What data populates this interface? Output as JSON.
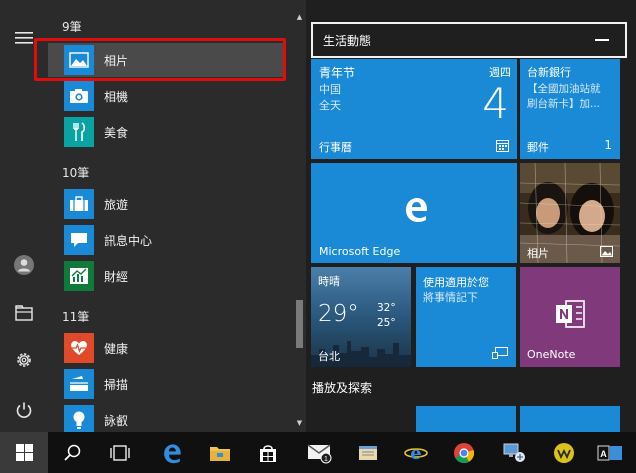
{
  "app_list": {
    "groups": [
      {
        "header": "9筆",
        "items": [
          {
            "label": "相片"
          },
          {
            "label": "相機"
          },
          {
            "label": "美食"
          }
        ]
      },
      {
        "header": "10筆",
        "items": [
          {
            "label": "旅遊"
          },
          {
            "label": "訊息中心"
          },
          {
            "label": "財經"
          }
        ]
      },
      {
        "header": "11筆",
        "items": [
          {
            "label": "健康"
          },
          {
            "label": "掃描"
          },
          {
            "label": "詠叡"
          }
        ]
      }
    ]
  },
  "tiles_section": {
    "header": "生活動態",
    "calendar": {
      "line1": "青年节",
      "line2": "中国",
      "line3": "全天",
      "weekday": "週四",
      "day": "4",
      "label": "行事曆"
    },
    "mail": {
      "line1": "台新銀行",
      "line2": "【全國加油站就",
      "line3": "刷台新卡】加...",
      "label": "郵件",
      "count": "1"
    },
    "edge": {
      "label": "Microsoft Edge"
    },
    "photos": {
      "label": "相片"
    },
    "weather": {
      "condition": "時晴",
      "temp": "29°",
      "high": "32°",
      "low": "25°",
      "city": "台北"
    },
    "getstarted": {
      "line1": "使用適用於您",
      "line2": "將事情記下"
    },
    "onenote": {
      "label": "OneNote"
    },
    "section2_header": "播放及探索"
  },
  "colors": {
    "tile_blue": "#1b8ad6",
    "onenote_purple": "#80397b",
    "highlight_red": "#e10d0d"
  }
}
